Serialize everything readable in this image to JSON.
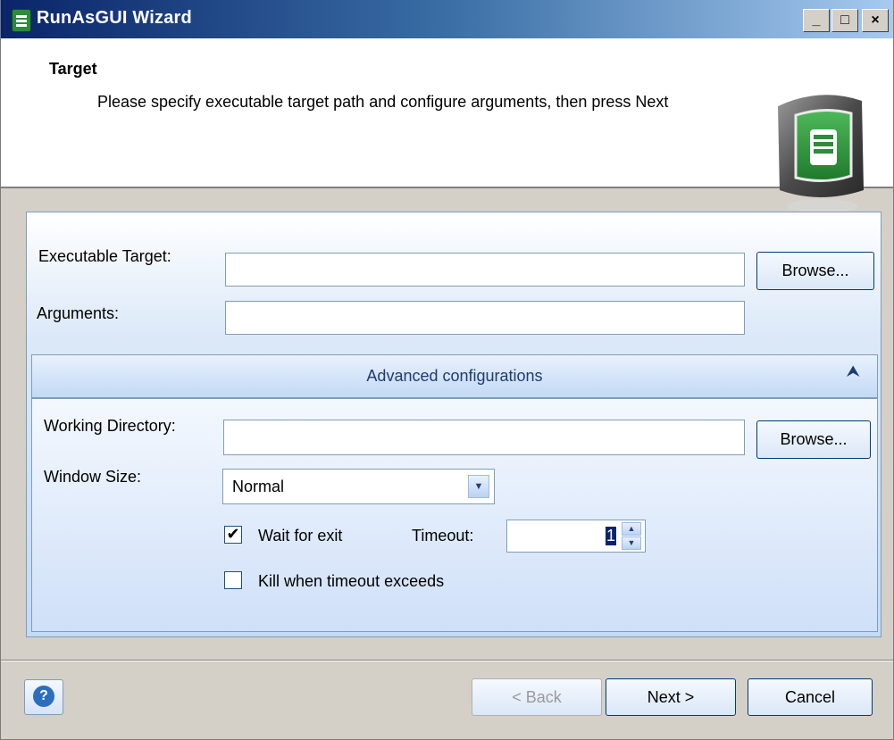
{
  "window": {
    "title": "RunAsGUI Wizard",
    "minimize": "_",
    "maximize": "□",
    "close": "×"
  },
  "header": {
    "title": "Target",
    "description": "Please specify executable target path and configure arguments, then press Next"
  },
  "form": {
    "executable_label": "Executable Target:",
    "executable_value": "",
    "browse_label": "Browse...",
    "arguments_label": "Arguments:",
    "arguments_value": ""
  },
  "advanced": {
    "header": "Advanced configurations",
    "collapse_icon": "chevron-double-up-icon",
    "collapse_glyph": "⮝",
    "working_dir_label": "Working Directory:",
    "working_dir_value": "",
    "browse_label": "Browse...",
    "window_size_label": "Window Size:",
    "window_size_value": "Normal",
    "dropdown_glyph": "▼",
    "wait_label": "Wait for exit",
    "wait_checked": true,
    "check_glyph": "✔",
    "timeout_label": "Timeout:",
    "timeout_value": "1",
    "spin_up": "▲",
    "spin_down": "▼",
    "kill_label": "Kill when timeout exceeds",
    "kill_checked": false
  },
  "footer": {
    "help": "?",
    "back": "< Back",
    "next": "Next >",
    "cancel": "Cancel"
  }
}
